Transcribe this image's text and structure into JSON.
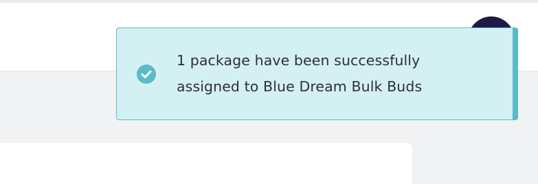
{
  "header": {
    "avatar_icon": "user-avatar"
  },
  "toast": {
    "type": "success",
    "icon": "check-circle-icon",
    "message": "1 package have been successfully assigned to Blue Dream Bulk Buds",
    "colors": {
      "background": "#d3f0f2",
      "accent": "#5bbac8",
      "text": "#2e2f33"
    }
  },
  "colors": {
    "page_background": "#f1f2f4",
    "avatar": "#1e1a47"
  }
}
